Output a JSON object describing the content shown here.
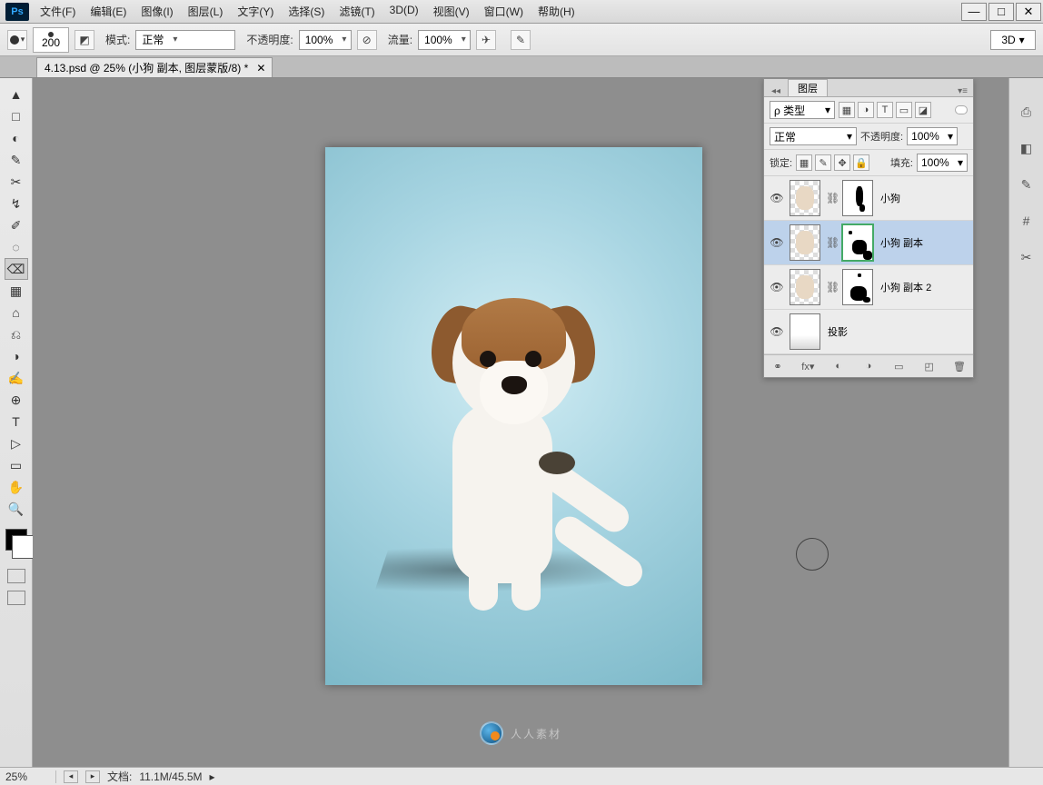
{
  "app": {
    "logo_text": "Ps"
  },
  "menu": [
    "文件(F)",
    "编辑(E)",
    "图像(I)",
    "图层(L)",
    "文字(Y)",
    "选择(S)",
    "滤镜(T)",
    "3D(D)",
    "视图(V)",
    "窗口(W)",
    "帮助(H)"
  ],
  "window_controls": {
    "min": "—",
    "max": "□",
    "close": "✕"
  },
  "options": {
    "brush_size": "200",
    "mode_label": "模式:",
    "mode_value": "正常",
    "opacity_label": "不透明度:",
    "opacity_value": "100%",
    "flow_label": "流量:",
    "flow_value": "100%",
    "workspace": "3D"
  },
  "document_tab": {
    "title": "4.13.psd @ 25% (小狗 副本, 图层蒙版/8) *",
    "close": "✕"
  },
  "tools": [
    "▲",
    "□",
    "◐",
    "✎",
    "✂",
    "↯",
    "✐",
    "◌",
    "⌫",
    "▦",
    "⌂",
    "⎌",
    "◑",
    "✍",
    "⊕",
    "T",
    "▷",
    "▭",
    "✋",
    "🔍"
  ],
  "tools_active_index": 8,
  "watermark": "人人素材",
  "right_icons": [
    "⎙",
    "◧",
    "✎",
    "#",
    "✂"
  ],
  "layers_panel": {
    "tab": "图层",
    "filter_prefix": "ρ",
    "filter_label": "类型",
    "filter_icons": [
      "▦",
      "◑",
      "T",
      "▭",
      "◪"
    ],
    "blend_mode": "正常",
    "opacity_label": "不透明度:",
    "opacity_value": "100%",
    "lock_label": "锁定:",
    "lock_icons": [
      "▦",
      "✎",
      "✥",
      "🔒"
    ],
    "fill_label": "填充:",
    "fill_value": "100%",
    "layers": [
      {
        "name": "小狗",
        "visible": true,
        "has_mask": true,
        "selected": false
      },
      {
        "name": "小狗 副本",
        "visible": true,
        "has_mask": true,
        "selected": true
      },
      {
        "name": "小狗 副本 2",
        "visible": true,
        "has_mask": true,
        "selected": false
      },
      {
        "name": "投影",
        "visible": true,
        "has_mask": false,
        "selected": false
      }
    ],
    "footer_icons": [
      "⚭",
      "fx▾",
      "◐",
      "◑",
      "▭",
      "◰",
      "🗑"
    ]
  },
  "statusbar": {
    "zoom": "25%",
    "doc_label": "文档:",
    "doc_value": "11.1M/45.5M"
  }
}
